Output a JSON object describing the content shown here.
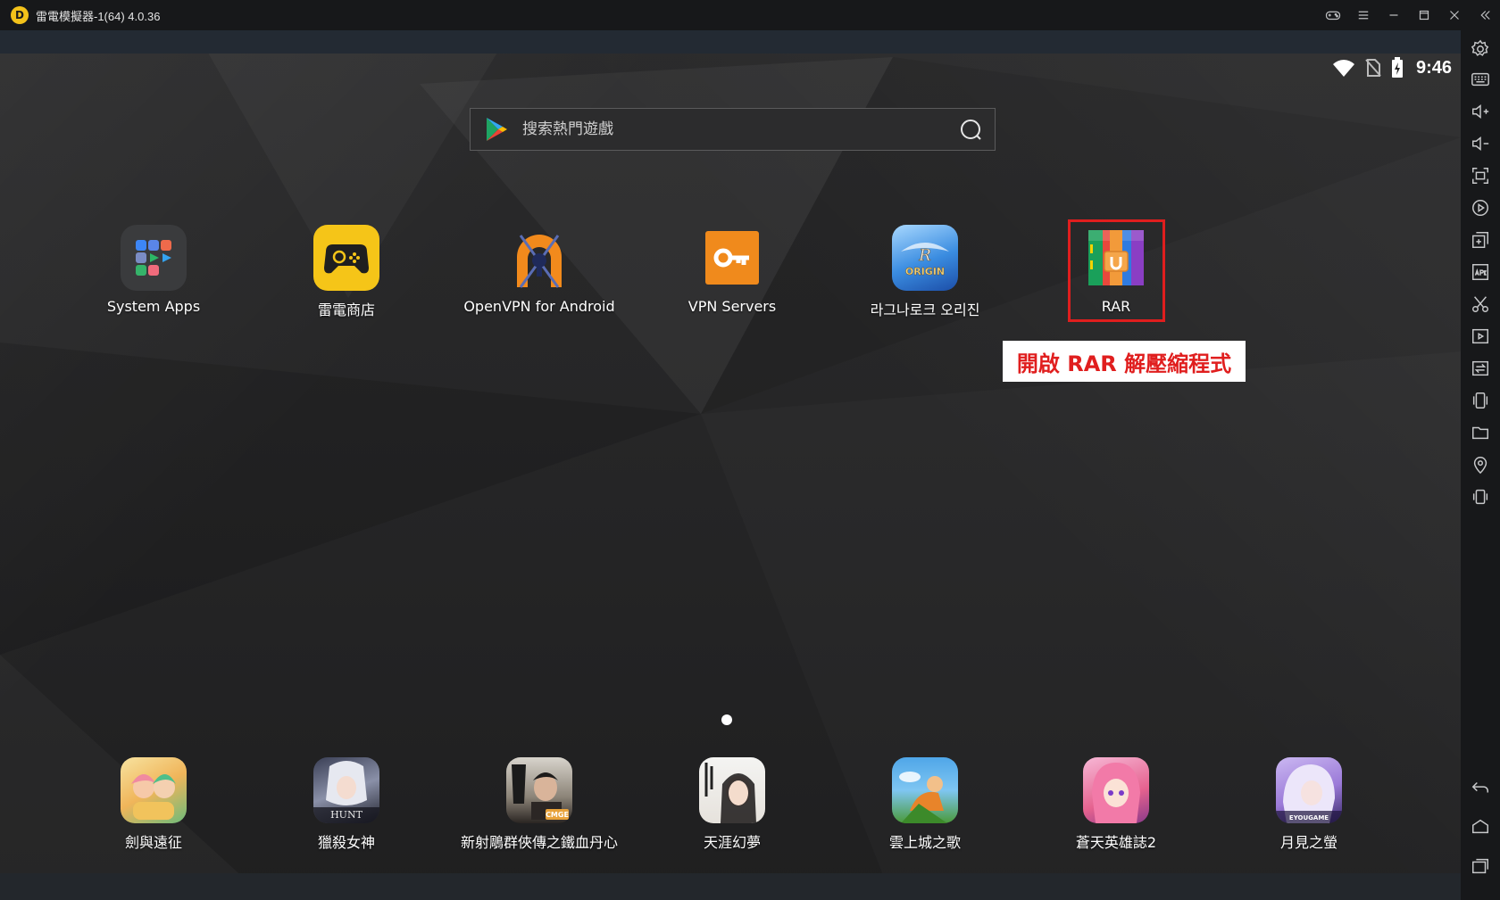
{
  "titlebar": {
    "logo_glyph": "D",
    "title": "雷電模擬器-1(64) 4.0.36",
    "controls": [
      "gamepad-icon",
      "menu-icon",
      "minimize-icon",
      "maximize-icon",
      "close-icon",
      "collapse-icon"
    ]
  },
  "status": {
    "time": "9:46",
    "icons": [
      "wifi-icon",
      "no-sim-icon",
      "battery-icon"
    ]
  },
  "search": {
    "placeholder": "搜索熱門遊戲"
  },
  "apps_top": [
    {
      "label": "System Apps"
    },
    {
      "label": "雷電商店"
    },
    {
      "label": "OpenVPN for Android"
    },
    {
      "label": "VPN Servers"
    },
    {
      "label": "라그나로크 오리진"
    },
    {
      "label": "RAR"
    }
  ],
  "apps_dock": [
    {
      "label": "劍與遠征"
    },
    {
      "label": "獵殺女神"
    },
    {
      "label": "新射鵰群俠傳之鐵血丹心"
    },
    {
      "label": "天涯幻夢"
    },
    {
      "label": "雲上城之歌"
    },
    {
      "label": "蒼天英雄誌2"
    },
    {
      "label": "月見之螢"
    }
  ],
  "icon_text": {
    "ro_logo": "ORIGIN",
    "hunt_logo": "HUNT",
    "cmge_logo": "CMGE",
    "eyou_logo": "EYOUGAME"
  },
  "annotation": {
    "text": "開啟 RAR 解壓縮程式",
    "color": "#e01e1e"
  },
  "sidebar": {
    "icons": [
      "settings-icon",
      "keyboard-icon",
      "volume-up-icon",
      "volume-down-icon",
      "screenshot-icon",
      "record-icon",
      "multi-instance-icon",
      "apk-icon",
      "cut-icon",
      "video-icon",
      "sync-icon",
      "shake-icon",
      "folder-icon",
      "location-icon",
      "rotate-icon",
      "back-icon",
      "home-icon",
      "recent-apps-icon"
    ]
  },
  "colors": {
    "accent": "#f3c21a",
    "highlight": "#e01e1e"
  }
}
